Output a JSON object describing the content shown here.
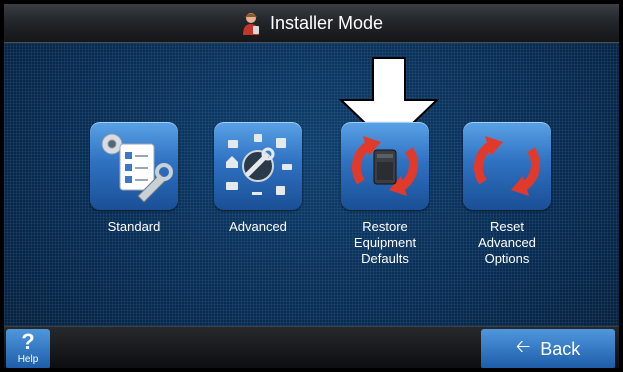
{
  "header": {
    "title": "Installer Mode",
    "icon": "installer-person-icon"
  },
  "menu": {
    "items": [
      {
        "label": "Standard",
        "icon": "standard-settings-icon"
      },
      {
        "label": "Advanced",
        "icon": "advanced-settings-icon"
      },
      {
        "label": "Restore\nEquipment\nDefaults",
        "icon": "restore-defaults-icon"
      },
      {
        "label": "Reset\nAdvanced\nOptions",
        "icon": "reset-options-icon"
      }
    ],
    "highlight": "down-arrow-indicator-icon"
  },
  "footer": {
    "help_symbol": "?",
    "help_label": "Help",
    "back_label": "Back",
    "back_icon": "back-arrow-icon"
  },
  "colors": {
    "background": "#082a4d",
    "tile_blue": "#2f72c2",
    "refresh_red": "#e23a2a",
    "button_blue": "#2f72c2"
  }
}
